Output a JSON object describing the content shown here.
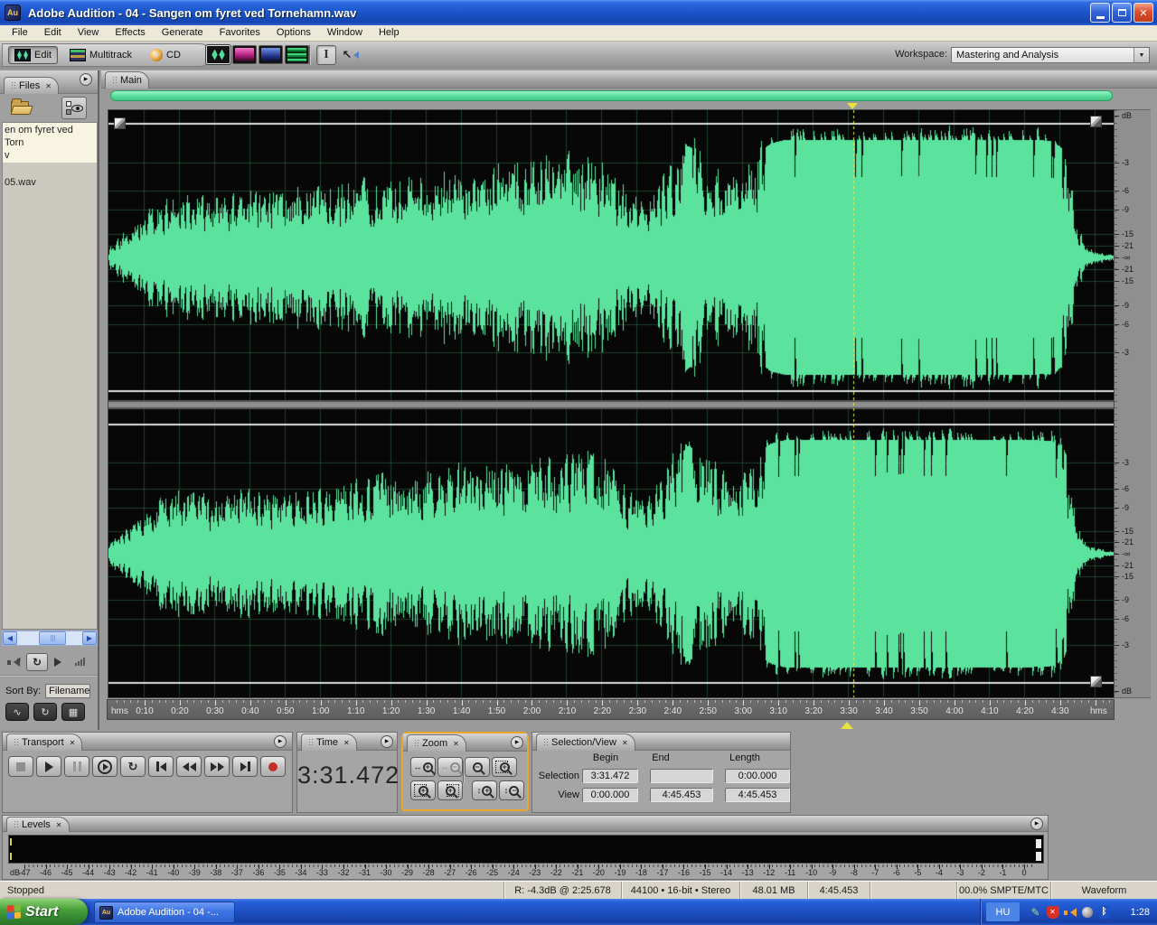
{
  "window": {
    "title": "Adobe Audition - 04 - Sangen om fyret ved Tornehamn.wav",
    "icon_text": "Au",
    "controls": [
      "minimize",
      "restore",
      "close"
    ]
  },
  "menu_bar": {
    "items": [
      "File",
      "Edit",
      "View",
      "Effects",
      "Generate",
      "Favorites",
      "Options",
      "Window",
      "Help"
    ]
  },
  "toolbar": {
    "mode_buttons": [
      {
        "name": "edit-view-button",
        "label": "Edit",
        "active": true
      },
      {
        "name": "multitrack-view-button",
        "label": "Multitrack",
        "active": false
      },
      {
        "name": "cd-view-button",
        "label": "CD",
        "active": false
      }
    ],
    "view_buttons": [
      {
        "name": "waveform-display-button",
        "active": true
      },
      {
        "name": "spectral-frequency-display-button",
        "active": false
      },
      {
        "name": "spectral-pan-display-button",
        "active": false
      },
      {
        "name": "spectral-phase-display-button",
        "active": false
      }
    ],
    "tool_buttons": [
      {
        "name": "time-selection-tool",
        "active": true
      },
      {
        "name": "scrub-tool",
        "active": false
      }
    ],
    "workspace": {
      "label": "Workspace:",
      "value": "Mastering and Analysis"
    }
  },
  "files_panel": {
    "tab_label": "Files",
    "items": [
      {
        "display_lines": [
          "en om fyret ved Torn",
          "v"
        ],
        "selected": true
      },
      {
        "display_lines": [
          "05.wav"
        ],
        "selected": false
      }
    ],
    "sort_by_label": "Sort By:",
    "sort_by_value": "Filename"
  },
  "main_panel": {
    "tab_label": "Main"
  },
  "timeline": {
    "left_unit": "hms",
    "right_unit": "hms",
    "seconds_per_label": 10,
    "tick_labels": [
      "0:10",
      "0:20",
      "0:30",
      "0:40",
      "0:50",
      "1:00",
      "1:10",
      "1:20",
      "1:30",
      "1:40",
      "1:50",
      "2:00",
      "2:10",
      "2:20",
      "2:30",
      "2:40",
      "2:50",
      "3:00",
      "3:10",
      "3:20",
      "3:30",
      "3:40",
      "3:50",
      "4:00",
      "4:10",
      "4:20",
      "4:30"
    ]
  },
  "db_ruler": {
    "unit_label": "dB",
    "tick_dbs": [
      3,
      6,
      9,
      15,
      21
    ],
    "infinity_label": "-∞"
  },
  "waveform": {
    "color": "#5BE39E",
    "grid_color": "rgba(46,122,78,0.5)",
    "background": "#070707",
    "duration_sec": 285.453,
    "cursor_sec": 211.472,
    "envelope": [
      [
        0,
        0.08
      ],
      [
        3,
        0.16
      ],
      [
        8,
        0.3
      ],
      [
        12,
        0.4
      ],
      [
        18,
        0.5
      ],
      [
        25,
        0.52
      ],
      [
        32,
        0.48
      ],
      [
        40,
        0.53
      ],
      [
        48,
        0.5
      ],
      [
        55,
        0.58
      ],
      [
        62,
        0.55
      ],
      [
        70,
        0.6
      ],
      [
        78,
        0.66
      ],
      [
        85,
        0.62
      ],
      [
        95,
        0.7
      ],
      [
        105,
        0.73
      ],
      [
        115,
        0.76
      ],
      [
        125,
        0.79
      ],
      [
        135,
        0.83
      ],
      [
        142,
        0.76
      ],
      [
        147,
        0.52
      ],
      [
        152,
        0.46
      ],
      [
        156,
        0.56
      ],
      [
        160,
        0.82
      ],
      [
        164,
        0.95
      ],
      [
        168,
        0.9
      ],
      [
        172,
        0.76
      ],
      [
        176,
        0.64
      ],
      [
        180,
        0.72
      ],
      [
        184,
        0.88
      ],
      [
        188,
        0.97
      ],
      [
        192,
        1
      ],
      [
        205,
        1
      ],
      [
        220,
        1
      ],
      [
        235,
        1
      ],
      [
        250,
        1
      ],
      [
        262,
        1
      ],
      [
        268,
        0.99
      ],
      [
        271,
        0.92
      ],
      [
        273,
        0.62
      ],
      [
        275,
        0.28
      ],
      [
        277,
        0.12
      ],
      [
        280,
        0.05
      ],
      [
        285,
        0.02
      ]
    ]
  },
  "transport_panel": {
    "tab_label": "Transport",
    "buttons": [
      "stop",
      "play",
      "pause",
      "play-from-cursor",
      "play-looped",
      "go-to-beginning",
      "rewind",
      "fast-forward",
      "go-to-end",
      "record"
    ]
  },
  "time_panel": {
    "tab_label": "Time",
    "value": "3:31.472"
  },
  "zoom_panel": {
    "tab_label": "Zoom",
    "active": true,
    "buttons": [
      "zoom-in-horizontal",
      "zoom-out-horizontal",
      "zoom-out-full",
      "zoom-to-selection",
      "zoom-in-left-edge",
      "zoom-in-right-edge",
      "zoom-in-vertical",
      "zoom-out-vertical"
    ]
  },
  "selection_view_panel": {
    "tab_label": "Selection/View",
    "columns": [
      "Begin",
      "End",
      "Length"
    ],
    "rows": [
      {
        "label": "Selection",
        "begin": "3:31.472",
        "end": "",
        "length": "0:00.000"
      },
      {
        "label": "View",
        "begin": "0:00.000",
        "end": "4:45.453",
        "length": "4:45.453"
      }
    ]
  },
  "levels_panel": {
    "tab_label": "Levels",
    "unit_label": "dB",
    "scale_min": -47,
    "scale_max": 0
  },
  "status_bar": {
    "segments": [
      "Stopped",
      "R: -4.3dB @ 2:25.678",
      "44100 • 16-bit • Stereo",
      "48.01 MB",
      "4:45.453",
      "",
      "00.0% SMPTE/MTC",
      "Waveform"
    ]
  },
  "taskbar": {
    "start_label": "Start",
    "task_button": {
      "icon_text": "Au",
      "label": "Adobe Audition - 04 -..."
    },
    "tray": {
      "language": "HU",
      "icons": [
        "tablet-pen-icon",
        "security-alert-icon",
        "volume-icon",
        "audio-monitor-icon",
        "bluetooth-icon"
      ],
      "clock": "1:28"
    }
  }
}
